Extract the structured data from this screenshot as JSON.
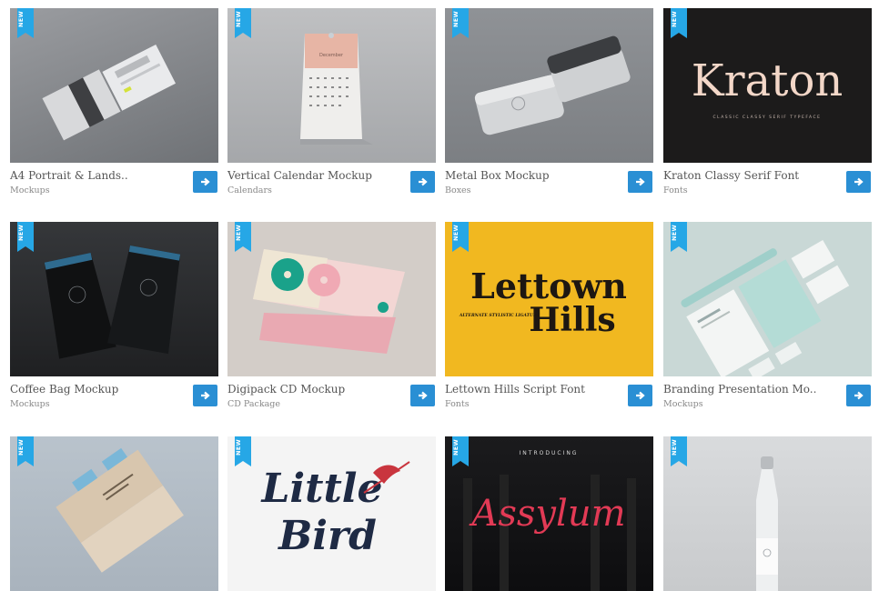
{
  "badge_label": "NEW",
  "colors": {
    "badge": "#26a7e6",
    "button": "#2a8fd4"
  },
  "items": [
    {
      "title": "A4 Portrait & Lands..",
      "category": "Mockups"
    },
    {
      "title": "Vertical Calendar Mockup",
      "category": "Calendars",
      "image_text": "December"
    },
    {
      "title": "Metal Box Mockup",
      "category": "Boxes"
    },
    {
      "title": "Kraton Classy Serif Font",
      "category": "Fonts",
      "image_text": "Kraton",
      "image_subtext": "CLASSIC CLASSY SERIF TYPEFACE"
    },
    {
      "title": "Coffee Bag Mockup",
      "category": "Mockups"
    },
    {
      "title": "Digipack CD Mockup",
      "category": "CD Package"
    },
    {
      "title": "Lettown Hills Script Font",
      "category": "Fonts",
      "image_text": "Lettown",
      "image_text2": "Hills",
      "image_subtext": "ALTERNATE STYLISTIC LIGATURE"
    },
    {
      "title": "Branding Presentation Mo..",
      "category": "Mockups"
    },
    {
      "title": "",
      "category": ""
    },
    {
      "title": "",
      "category": "",
      "image_text": "Little",
      "image_text2": "Bird"
    },
    {
      "title": "",
      "category": "",
      "image_text": "Assylum",
      "image_subtext": "INTRODUCING"
    },
    {
      "title": "",
      "category": ""
    }
  ]
}
